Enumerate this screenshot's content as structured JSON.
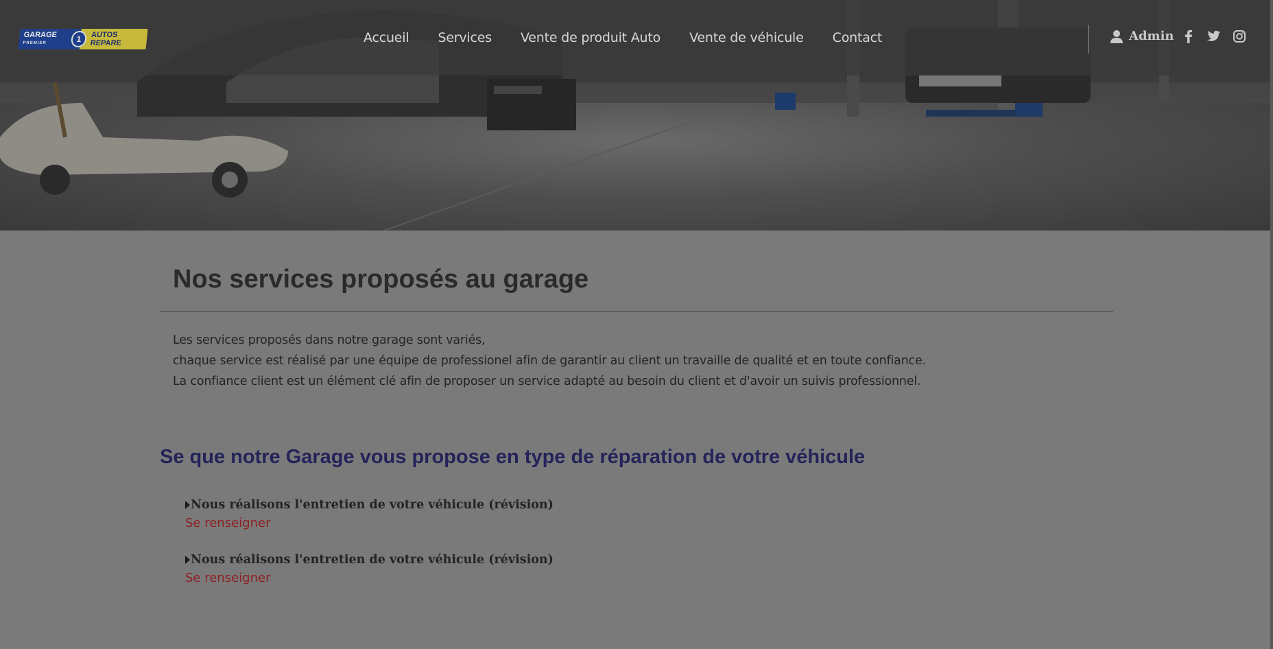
{
  "logo": {
    "left_text": "GARAGE",
    "sub_text": "PREMIER",
    "badge": "1",
    "right_text": "AUTOS REPARE"
  },
  "nav": {
    "items": [
      {
        "label": "Accueil"
      },
      {
        "label": "Services"
      },
      {
        "label": "Vente de produit Auto"
      },
      {
        "label": "Vente de véhicule"
      },
      {
        "label": "Contact"
      }
    ],
    "admin_label": "Admin"
  },
  "social": {
    "icons": [
      "facebook-icon",
      "twitter-icon",
      "instagram-icon"
    ]
  },
  "main": {
    "title": "Nos services proposés au garage",
    "intro_lines": [
      "Les services proposés dans notre garage sont variés,",
      "chaque service est réalisé par une équipe de professionel afin de garantir au client un travaille de qualité et en toute confiance.",
      "La confiance client est un élément clé afin de proposer un service adapté au besoin du client et d'avoir un suivis professionnel."
    ],
    "subtitle": "Se que notre Garage vous propose en type de réparation de votre véhicule",
    "services": [
      {
        "title": "Nous réalisons l'entretien de votre véhicule (révision)",
        "link": "Se renseigner"
      },
      {
        "title": "Nous réalisons l'entretien de votre véhicule (révision)",
        "link": "Se renseigner"
      }
    ]
  },
  "colors": {
    "overlay_bg": "#7a7a7a",
    "subtitle": "#24235a",
    "link": "#8e1f22",
    "nav_text": "#d7d7d7"
  }
}
